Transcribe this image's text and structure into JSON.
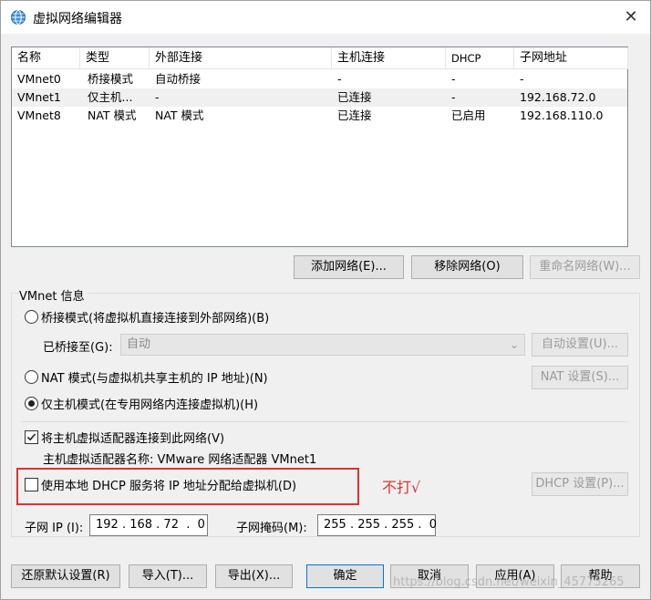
{
  "window": {
    "title": "虚拟网络编辑器",
    "close_glyph": "✕"
  },
  "table": {
    "columns": [
      "名称",
      "类型",
      "外部连接",
      "主机连接",
      "DHCP",
      "子网地址"
    ],
    "rows": [
      [
        "VMnet0",
        "桥接模式",
        "自动桥接",
        "-",
        "-",
        "-"
      ],
      [
        "VMnet1",
        "仅主机...",
        "-",
        "已连接",
        "-",
        "192.168.72.0"
      ],
      [
        "VMnet8",
        "NAT 模式",
        "NAT 模式",
        "已连接",
        "已启用",
        "192.168.110.0"
      ]
    ],
    "selected_row": 1
  },
  "network_buttons": {
    "add": "添加网络(E)...",
    "remove": "移除网络(O)",
    "rename": "重命名网络(W)..."
  },
  "vmnet_info": {
    "group_label": "VMnet 信息",
    "bridge_radio": "桥接模式(将虚拟机直接连接到外部网络)(B)",
    "bridged_to_label": "已桥接至(G):",
    "bridged_to_value": "自动",
    "auto_settings": "自动设置(U)...",
    "nat_radio": "NAT 模式(与虚拟机共享主机的 IP 地址)(N)",
    "nat_settings": "NAT 设置(S)...",
    "host_only_radio": "仅主机模式(在专用网络内连接虚拟机)(H)",
    "selected_mode": "host_only",
    "connect_adapter_check": "将主机虚拟适配器连接到此网络(V)",
    "connect_adapter_checked": true,
    "adapter_name_label": "主机虚拟适配器名称: VMware 网络适配器 VMnet1",
    "dhcp_check": "使用本地 DHCP 服务将 IP 地址分配给虚拟机(D)",
    "dhcp_checked": false,
    "dhcp_settings": "DHCP 设置(P)...",
    "subnet_ip_label": "子网 IP (I):",
    "subnet_ip_value": "192 . 168 . 72  .  0",
    "subnet_mask_label": "子网掩码(M):",
    "subnet_mask_value": "255 . 255 . 255 .  0"
  },
  "annotation": {
    "text": "不打√",
    "color": "#e03030"
  },
  "footer_buttons": {
    "restore": "还原默认设置(R)",
    "import": "导入(T)...",
    "export": "导出(X)...",
    "ok": "确定",
    "cancel": "取消",
    "apply": "应用(A)",
    "help": "帮助"
  },
  "watermark": "https://blog.csdn.net/weixin_45773265"
}
